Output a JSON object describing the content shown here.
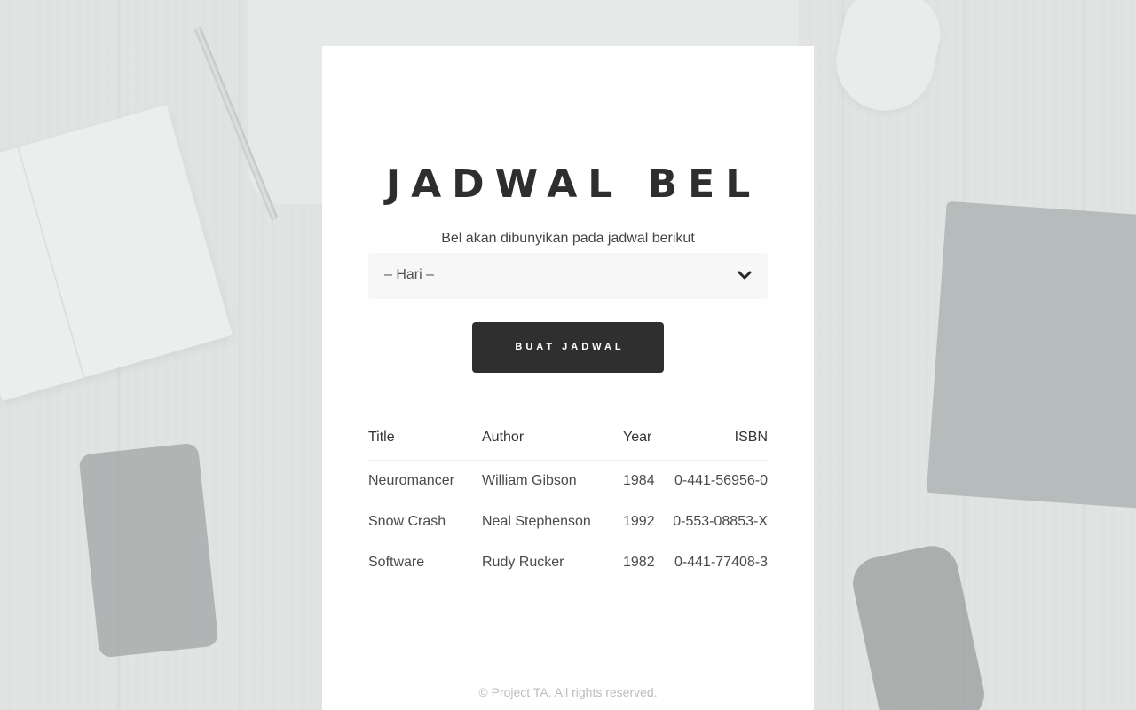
{
  "page": {
    "title": "JADWAL BEL",
    "subtitle": "Bel akan dibunyikan pada jadwal berikut"
  },
  "form": {
    "day_select_value": "– Hari –",
    "submit_label": "BUAT JADWAL"
  },
  "table": {
    "columns": [
      "Title",
      "Author",
      "Year",
      "ISBN"
    ],
    "rows": [
      [
        "Neuromancer",
        "William Gibson",
        "1984",
        "0-441-56956-0"
      ],
      [
        "Snow Crash",
        "Neal Stephenson",
        "1992",
        "0-553-08853-X"
      ],
      [
        "Software",
        "Rudy Rucker",
        "1982",
        "0-441-77408-3"
      ]
    ]
  },
  "footer": {
    "text": "© Project TA. All rights reserved."
  },
  "icons": {
    "select_chevron": "chevron-down-icon"
  },
  "colors": {
    "button_bg": "#2f2f2f",
    "card_bg": "#ffffff",
    "select_bg": "#f7f7f7"
  }
}
